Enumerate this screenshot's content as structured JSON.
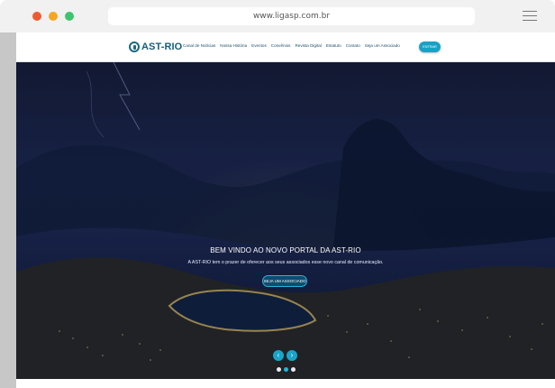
{
  "browser": {
    "url": "www.ligasp.com.br"
  },
  "site": {
    "logo": "AST-RIO",
    "nav": [
      "Canal de Notícias",
      "Nossa História",
      "Eventos",
      "Convênios",
      "Revista Digital",
      "Estatuto",
      "Contato",
      "Seja um Associado"
    ],
    "enter_label": "ENTRAR"
  },
  "hero": {
    "title": "BEM VINDO AO NOVO PORTAL DA AST-RIO",
    "subtitle": "A AST-RIO tem o prazer de oferecer aos seus associados esse novo canal de comunicação.",
    "cta_label": "SEJA UM ASSOCIADO"
  },
  "slider": {
    "prev_icon": "chevron-left-icon",
    "next_icon": "chevron-right-icon",
    "active_index": 1,
    "dot_count": 3
  },
  "colors": {
    "brand": "#155e78",
    "accent": "#19a1c6",
    "hero_dark": "#0e1a33"
  }
}
